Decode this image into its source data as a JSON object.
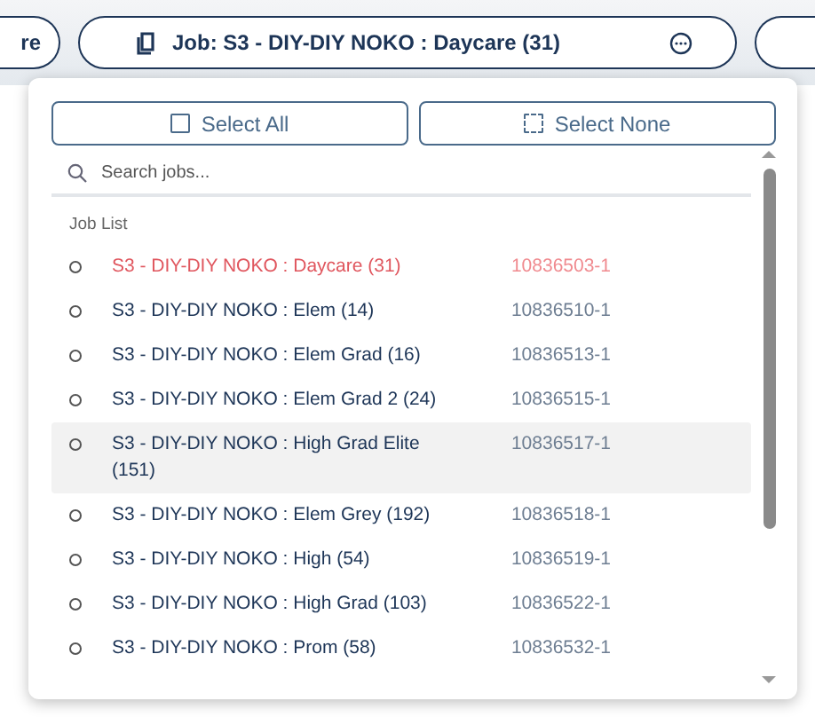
{
  "tabs": [
    {
      "label": "re"
    },
    {
      "label": "Job: S3 - DIY-DIY NOKO : Daycare (31)"
    }
  ],
  "dropdown": {
    "buttons": [
      {
        "label": "Select All",
        "kind": "all"
      },
      {
        "label": "Select None",
        "kind": "none"
      }
    ],
    "search": {
      "placeholder": "Search jobs..."
    },
    "list_title": "Job List",
    "items": [
      {
        "name": "S3 - DIY-DIY NOKO : Daycare (31)",
        "id": "10836503-1",
        "current": true,
        "highlighted": false
      },
      {
        "name": "S3 - DIY-DIY NOKO : Elem (14)",
        "id": "10836510-1",
        "current": false,
        "highlighted": false
      },
      {
        "name": "S3 - DIY-DIY NOKO : Elem Grad (16)",
        "id": "10836513-1",
        "current": false,
        "highlighted": false
      },
      {
        "name": "S3 - DIY-DIY NOKO : Elem Grad 2 (24)",
        "id": "10836515-1",
        "current": false,
        "highlighted": false
      },
      {
        "name": "S3 - DIY-DIY NOKO : High Grad Elite (151)",
        "id": "10836517-1",
        "current": false,
        "highlighted": true
      },
      {
        "name": "S3 - DIY-DIY NOKO : Elem Grey (192)",
        "id": "10836518-1",
        "current": false,
        "highlighted": false
      },
      {
        "name": "S3 - DIY-DIY NOKO : High (54)",
        "id": "10836519-1",
        "current": false,
        "highlighted": false
      },
      {
        "name": "S3 - DIY-DIY NOKO : High Grad (103)",
        "id": "10836522-1",
        "current": false,
        "highlighted": false
      },
      {
        "name": "S3 - DIY-DIY NOKO : Prom (58)",
        "id": "10836532-1",
        "current": false,
        "highlighted": false
      }
    ]
  }
}
